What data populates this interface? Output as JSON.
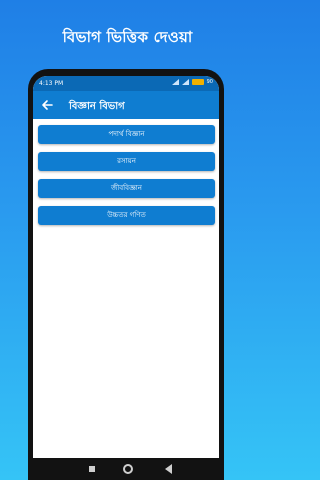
{
  "headline": "বিভাগ ভিত্তিক দেওয়া",
  "status_bar": {
    "time": "4:13 PM",
    "battery": "90"
  },
  "app_bar": {
    "title": "বিজ্ঞান বিভাগ",
    "back_icon": "arrow-left-icon"
  },
  "subjects": [
    {
      "label": "পদার্থ বিজ্ঞান"
    },
    {
      "label": "রসায়ন"
    },
    {
      "label": "জীববিজ্ঞান"
    },
    {
      "label": "উচ্চতর গণিত"
    }
  ],
  "colors": {
    "accent": "#0f7dd1",
    "status": "#0b69b5",
    "background": "#2a9bef"
  }
}
